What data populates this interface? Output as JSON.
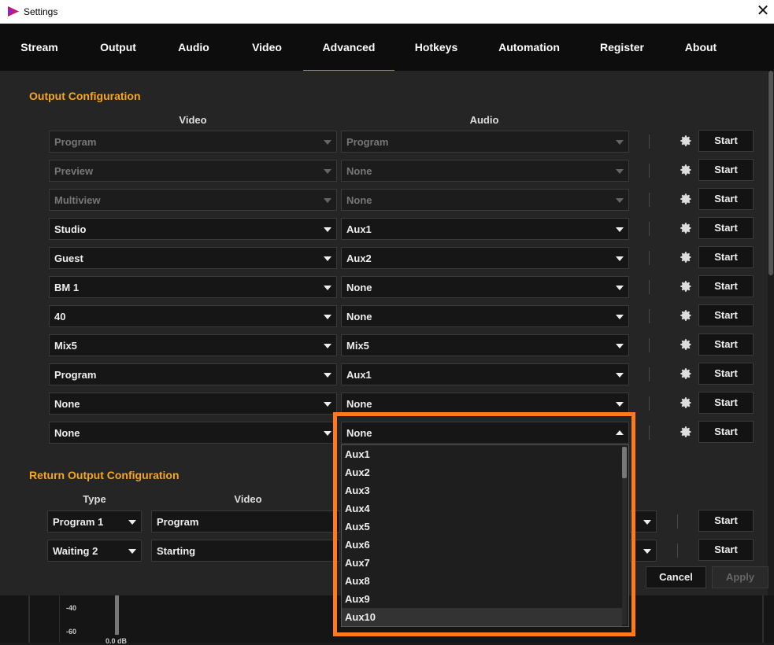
{
  "window": {
    "title": "Settings",
    "close": "✕"
  },
  "tabs": [
    "Stream",
    "Output",
    "Audio",
    "Video",
    "Advanced",
    "Hotkeys",
    "Automation",
    "Register",
    "About"
  ],
  "active_tab": "Advanced",
  "output_config": {
    "title": "Output Configuration",
    "video_header": "Video",
    "audio_header": "Audio",
    "rows": [
      {
        "video": "Program",
        "audio": "Program",
        "disabled": true
      },
      {
        "video": "Preview",
        "audio": "None",
        "disabled": true
      },
      {
        "video": "Multiview",
        "audio": "None",
        "disabled": true
      },
      {
        "video": "Studio",
        "audio": "Aux1",
        "disabled": false
      },
      {
        "video": "Guest",
        "audio": "Aux2",
        "disabled": false
      },
      {
        "video": "BM 1",
        "audio": "None",
        "disabled": false
      },
      {
        "video": "40",
        "audio": "None",
        "disabled": false
      },
      {
        "video": "Mix5",
        "audio": "Mix5",
        "disabled": false
      },
      {
        "video": "Program",
        "audio": "Aux1",
        "disabled": false
      },
      {
        "video": "None",
        "audio": "None",
        "disabled": false
      },
      {
        "video": "None",
        "audio": "None",
        "disabled": false
      }
    ],
    "start_label": "Start"
  },
  "dropdown_open": {
    "selected": "None",
    "options": [
      "Aux1",
      "Aux2",
      "Aux3",
      "Aux4",
      "Aux5",
      "Aux6",
      "Aux7",
      "Aux8",
      "Aux9",
      "Aux10"
    ],
    "hovered": "Aux10"
  },
  "return_config": {
    "title": "Return Output Configuration",
    "type_header": "Type",
    "video_header": "Video",
    "rows": [
      {
        "type": "Program 1",
        "video": "Program"
      },
      {
        "type": "Waiting 2",
        "video": "Starting"
      }
    ],
    "start_label": "Start"
  },
  "footer": {
    "cancel": "Cancel",
    "apply": "Apply"
  },
  "meter": {
    "labels": [
      "-40",
      "-60"
    ],
    "readout": "0.0 dB"
  },
  "colors": {
    "accent": "#f5a623",
    "highlight": "#ff7a1a"
  }
}
